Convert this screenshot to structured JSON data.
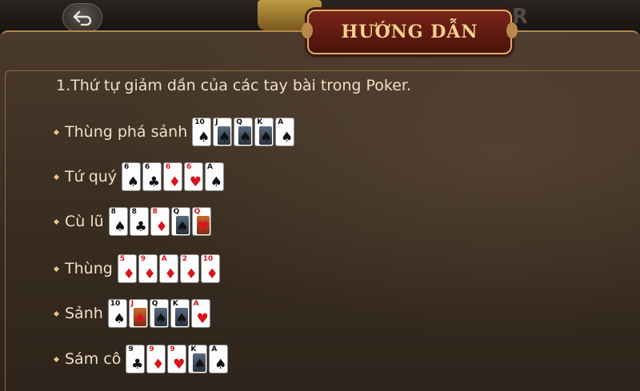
{
  "header": {
    "back_icon": "back-arrow-icon",
    "game_label": "KER"
  },
  "title": "HƯỚNG DẪN",
  "heading": "1.Thứ tự giảm dần của các tay bài trong Poker.",
  "hands": [
    {
      "label": "Thùng phá sảnh",
      "cards": [
        {
          "rank": "10",
          "suit": "♠",
          "color": "black",
          "face": false
        },
        {
          "rank": "J",
          "suit": "♠",
          "color": "black",
          "face": true
        },
        {
          "rank": "Q",
          "suit": "♠",
          "color": "black",
          "face": true
        },
        {
          "rank": "K",
          "suit": "♠",
          "color": "black",
          "face": true
        },
        {
          "rank": "A",
          "suit": "♠",
          "color": "black",
          "face": false
        }
      ]
    },
    {
      "label": "Tứ quý",
      "cards": [
        {
          "rank": "6",
          "suit": "♠",
          "color": "black",
          "face": false
        },
        {
          "rank": "6",
          "suit": "♣",
          "color": "black",
          "face": false
        },
        {
          "rank": "6",
          "suit": "♦",
          "color": "red",
          "face": false
        },
        {
          "rank": "6",
          "suit": "♥",
          "color": "red",
          "face": false
        },
        {
          "rank": "A",
          "suit": "♠",
          "color": "black",
          "face": false
        }
      ]
    },
    {
      "label": "Cù lũ",
      "cards": [
        {
          "rank": "8",
          "suit": "♠",
          "color": "black",
          "face": false
        },
        {
          "rank": "8",
          "suit": "♣",
          "color": "black",
          "face": false
        },
        {
          "rank": "8",
          "suit": "♦",
          "color": "red",
          "face": false
        },
        {
          "rank": "Q",
          "suit": "♠",
          "color": "black",
          "face": true
        },
        {
          "rank": "Q",
          "suit": "♥",
          "color": "red",
          "face": true
        }
      ]
    },
    {
      "label": "Thùng",
      "cards": [
        {
          "rank": "5",
          "suit": "♦",
          "color": "red",
          "face": false
        },
        {
          "rank": "9",
          "suit": "♦",
          "color": "red",
          "face": false
        },
        {
          "rank": "A",
          "suit": "♦",
          "color": "red",
          "face": false
        },
        {
          "rank": "2",
          "suit": "♦",
          "color": "red",
          "face": false
        },
        {
          "rank": "10",
          "suit": "♦",
          "color": "red",
          "face": false
        }
      ]
    },
    {
      "label": "Sảnh",
      "cards": [
        {
          "rank": "10",
          "suit": "♠",
          "color": "black",
          "face": false
        },
        {
          "rank": "J",
          "suit": "♦",
          "color": "red",
          "face": true
        },
        {
          "rank": "Q",
          "suit": "♠",
          "color": "black",
          "face": true
        },
        {
          "rank": "K",
          "suit": "♠",
          "color": "black",
          "face": true
        },
        {
          "rank": "A",
          "suit": "♥",
          "color": "red",
          "face": false
        }
      ]
    },
    {
      "label": "Sám cô",
      "cards": [
        {
          "rank": "9",
          "suit": "♣",
          "color": "black",
          "face": false
        },
        {
          "rank": "9",
          "suit": "♦",
          "color": "red",
          "face": false
        },
        {
          "rank": "9",
          "suit": "♥",
          "color": "red",
          "face": false
        },
        {
          "rank": "K",
          "suit": "♠",
          "color": "black",
          "face": true
        },
        {
          "rank": "A",
          "suit": "♠",
          "color": "black",
          "face": false
        }
      ]
    }
  ]
}
